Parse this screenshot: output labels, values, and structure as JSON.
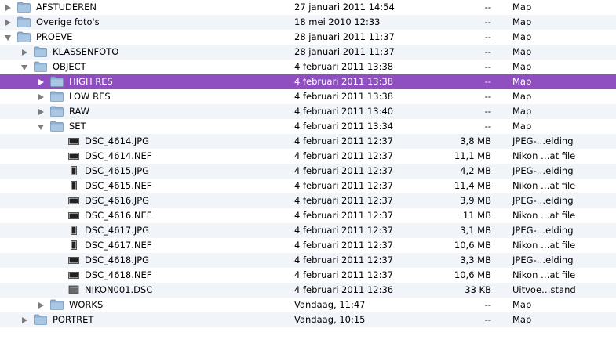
{
  "rows": [
    {
      "name": "AFSTUDEREN",
      "date": "27 januari 2011 14:54",
      "size": "--",
      "kind": "Map",
      "level": 0,
      "type": "folder",
      "disclosure": "closed",
      "icon": "folder-icon"
    },
    {
      "name": "Overige foto's",
      "date": "18 mei 2010 12:33",
      "size": "--",
      "kind": "Map",
      "level": 0,
      "type": "folder",
      "disclosure": "closed",
      "icon": "folder-icon"
    },
    {
      "name": "PROEVE",
      "date": "28 januari 2011 11:37",
      "size": "--",
      "kind": "Map",
      "level": 0,
      "type": "folder",
      "disclosure": "open",
      "icon": "folder-icon"
    },
    {
      "name": "KLASSENFOTO",
      "date": "28 januari 2011 11:37",
      "size": "--",
      "kind": "Map",
      "level": 1,
      "type": "folder",
      "disclosure": "closed",
      "icon": "folder-icon"
    },
    {
      "name": "OBJECT",
      "date": "4 februari 2011 13:38",
      "size": "--",
      "kind": "Map",
      "level": 1,
      "type": "folder",
      "disclosure": "open",
      "icon": "folder-icon"
    },
    {
      "name": "HIGH RES",
      "date": "4 februari 2011 13:38",
      "size": "--",
      "kind": "Map",
      "level": 2,
      "type": "folder",
      "disclosure": "closed",
      "icon": "folder-icon",
      "selected": true
    },
    {
      "name": "LOW RES",
      "date": "4 februari 2011 13:38",
      "size": "--",
      "kind": "Map",
      "level": 2,
      "type": "folder",
      "disclosure": "closed",
      "icon": "folder-icon"
    },
    {
      "name": "RAW",
      "date": "4 februari 2011 13:40",
      "size": "--",
      "kind": "Map",
      "level": 2,
      "type": "folder",
      "disclosure": "closed",
      "icon": "folder-icon"
    },
    {
      "name": "SET",
      "date": "4 februari 2011 13:34",
      "size": "--",
      "kind": "Map",
      "level": 2,
      "type": "folder",
      "disclosure": "open",
      "icon": "folder-icon"
    },
    {
      "name": "DSC_4614.JPG",
      "date": "4 februari 2011 12:37",
      "size": "3,8 MB",
      "kind": "JPEG-…elding",
      "level": 3,
      "type": "file",
      "icon": "image-landscape-icon"
    },
    {
      "name": "DSC_4614.NEF",
      "date": "4 februari 2011 12:37",
      "size": "11,1 MB",
      "kind": "Nikon …at file",
      "level": 3,
      "type": "file",
      "icon": "image-landscape-icon"
    },
    {
      "name": "DSC_4615.JPG",
      "date": "4 februari 2011 12:37",
      "size": "4,2 MB",
      "kind": "JPEG-…elding",
      "level": 3,
      "type": "file",
      "icon": "image-portrait-icon"
    },
    {
      "name": "DSC_4615.NEF",
      "date": "4 februari 2011 12:37",
      "size": "11,4 MB",
      "kind": "Nikon …at file",
      "level": 3,
      "type": "file",
      "icon": "image-portrait-icon"
    },
    {
      "name": "DSC_4616.JPG",
      "date": "4 februari 2011 12:37",
      "size": "3,9 MB",
      "kind": "JPEG-…elding",
      "level": 3,
      "type": "file",
      "icon": "image-landscape-icon"
    },
    {
      "name": "DSC_4616.NEF",
      "date": "4 februari 2011 12:37",
      "size": "11 MB",
      "kind": "Nikon …at file",
      "level": 3,
      "type": "file",
      "icon": "image-landscape-icon"
    },
    {
      "name": "DSC_4617.JPG",
      "date": "4 februari 2011 12:37",
      "size": "3,1 MB",
      "kind": "JPEG-…elding",
      "level": 3,
      "type": "file",
      "icon": "image-portrait-icon"
    },
    {
      "name": "DSC_4617.NEF",
      "date": "4 februari 2011 12:37",
      "size": "10,6 MB",
      "kind": "Nikon …at file",
      "level": 3,
      "type": "file",
      "icon": "image-portrait-icon"
    },
    {
      "name": "DSC_4618.JPG",
      "date": "4 februari 2011 12:37",
      "size": "3,3 MB",
      "kind": "JPEG-…elding",
      "level": 3,
      "type": "file",
      "icon": "image-landscape-icon"
    },
    {
      "name": "DSC_4618.NEF",
      "date": "4 februari 2011 12:37",
      "size": "10,6 MB",
      "kind": "Nikon …at file",
      "level": 3,
      "type": "file",
      "icon": "image-landscape-icon"
    },
    {
      "name": "NIKON001.DSC",
      "date": "4 februari 2011 12:36",
      "size": "33 KB",
      "kind": "Uitvoe…stand",
      "level": 3,
      "type": "file",
      "icon": "document-icon"
    },
    {
      "name": "WORKS",
      "date": "Vandaag, 11:47",
      "size": "--",
      "kind": "Map",
      "level": 2,
      "type": "folder",
      "disclosure": "closed",
      "icon": "folder-icon"
    },
    {
      "name": "PORTRET",
      "date": "Vandaag, 10:15",
      "size": "--",
      "kind": "Map",
      "level": 1,
      "type": "folder",
      "disclosure": "closed",
      "icon": "folder-icon"
    }
  ],
  "colors": {
    "selection": "#8f4fc0",
    "alternate_row": "#f1f5fa",
    "folder": "#9ab9d6"
  }
}
